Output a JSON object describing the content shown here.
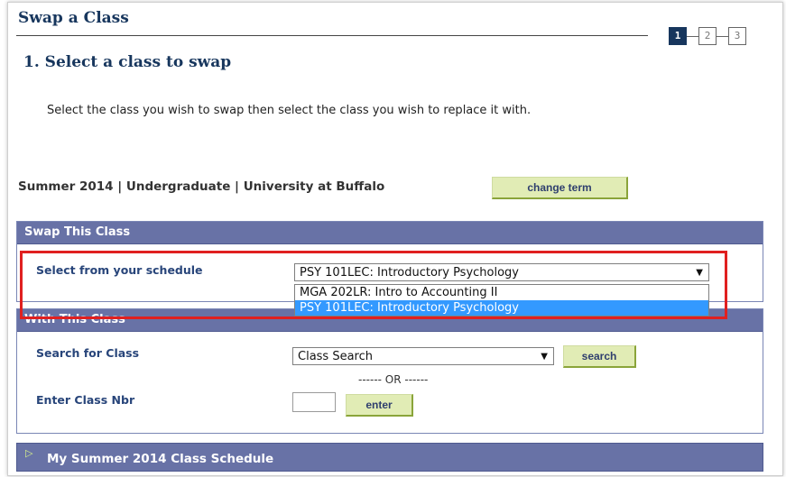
{
  "page": {
    "title": "Swap a Class",
    "step_heading": "1.  Select a class to swap",
    "instructions": "Select the class you wish to swap then select the class you wish to replace it with."
  },
  "steps": [
    {
      "label": "1",
      "active": true
    },
    {
      "label": "2",
      "active": false
    },
    {
      "label": "3",
      "active": false
    }
  ],
  "term": {
    "text": "Summer 2014 | Undergraduate | University at Buffalo",
    "change_term_label": "change term"
  },
  "swap_panel": {
    "header": "Swap This Class",
    "field_label": "Select from your schedule",
    "selected_value": "PSY 101LEC: Introductory Psychology",
    "options": [
      {
        "label": "MGA 202LR: Intro to Accounting II",
        "selected": false
      },
      {
        "label": "PSY 101LEC: Introductory Psychology",
        "selected": true
      }
    ]
  },
  "with_panel": {
    "header": "With This Class",
    "search_label": "Search for Class",
    "search_select_value": "Class Search",
    "search_button": "search",
    "or_text": "------ OR ------",
    "class_nbr_label": "Enter Class Nbr",
    "class_nbr_value": "",
    "enter_button": "enter"
  },
  "schedule_panel": {
    "label": "My Summer 2014 Class Schedule"
  },
  "colors": {
    "header_bg": "#6872a6",
    "title_color": "#17365d",
    "button_bg": "#e1ecb5",
    "highlight": "#e02020",
    "dropdown_selected": "#3399ff"
  }
}
